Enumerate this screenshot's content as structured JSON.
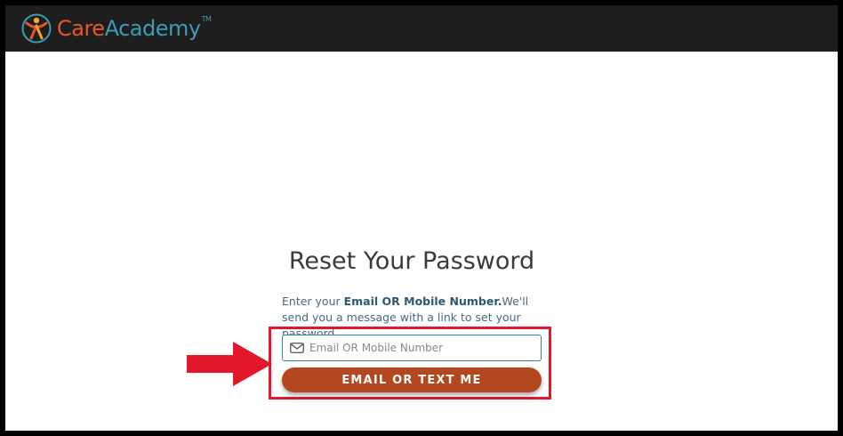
{
  "header": {
    "logo_care": "Care",
    "logo_academy": "Academy",
    "logo_tm": "TM"
  },
  "main": {
    "title": "Reset Your Password",
    "desc_prefix": "Enter your ",
    "desc_bold": "Email OR Mobile Number.",
    "desc_suffix": "We'll send you a message with a link to set your password.",
    "input_placeholder": "Email OR Mobile Number",
    "input_value": "",
    "submit_label": "EMAIL OR TEXT ME"
  },
  "icons": {
    "input_icon": "mail-icon",
    "annotation": "arrow-right-icon"
  },
  "colors": {
    "topbar": "#1e1e1e",
    "logo_care": "#e8552a",
    "logo_academy": "#3a9db5",
    "button": "#b5471e",
    "annotation": "#e3172c"
  }
}
